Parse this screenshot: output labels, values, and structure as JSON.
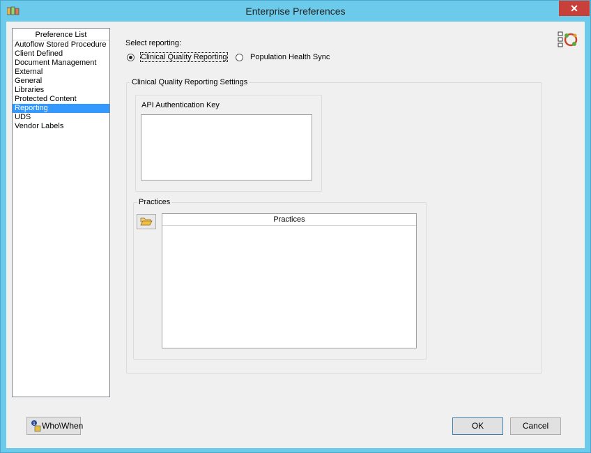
{
  "window": {
    "title": "Enterprise Preferences",
    "close_glyph": "✕"
  },
  "pref_list": {
    "header": "Preference List",
    "items": [
      "Autoflow Stored Procedure",
      "Client Defined",
      "Document Management",
      "External",
      "General",
      "Libraries",
      "Protected Content",
      "Reporting",
      "UDS",
      "Vendor Labels"
    ],
    "selected": "Reporting"
  },
  "reporting": {
    "select_label": "Select reporting:",
    "options": [
      "Clinical Quality Reporting",
      "Population Health Sync"
    ],
    "selected": "Clinical Quality Reporting"
  },
  "cqr_settings": {
    "title": "Clinical Quality Reporting Settings",
    "api_key": {
      "title": "API Authentication Key",
      "value": ""
    },
    "practices": {
      "title": "Practices",
      "column": "Practices",
      "rows": []
    }
  },
  "footer": {
    "whowhen_label": "Who\\When",
    "ok_label": "OK",
    "cancel_label": "Cancel"
  },
  "icons": [
    "app-icon",
    "close-icon",
    "folder-open-icon",
    "who-when-icon",
    "preferences-icon"
  ],
  "colors": {
    "titlebar": "#6ccbeb",
    "close": "#c7403a",
    "selection": "#3399ff",
    "dialog": "#f0f0f0"
  }
}
